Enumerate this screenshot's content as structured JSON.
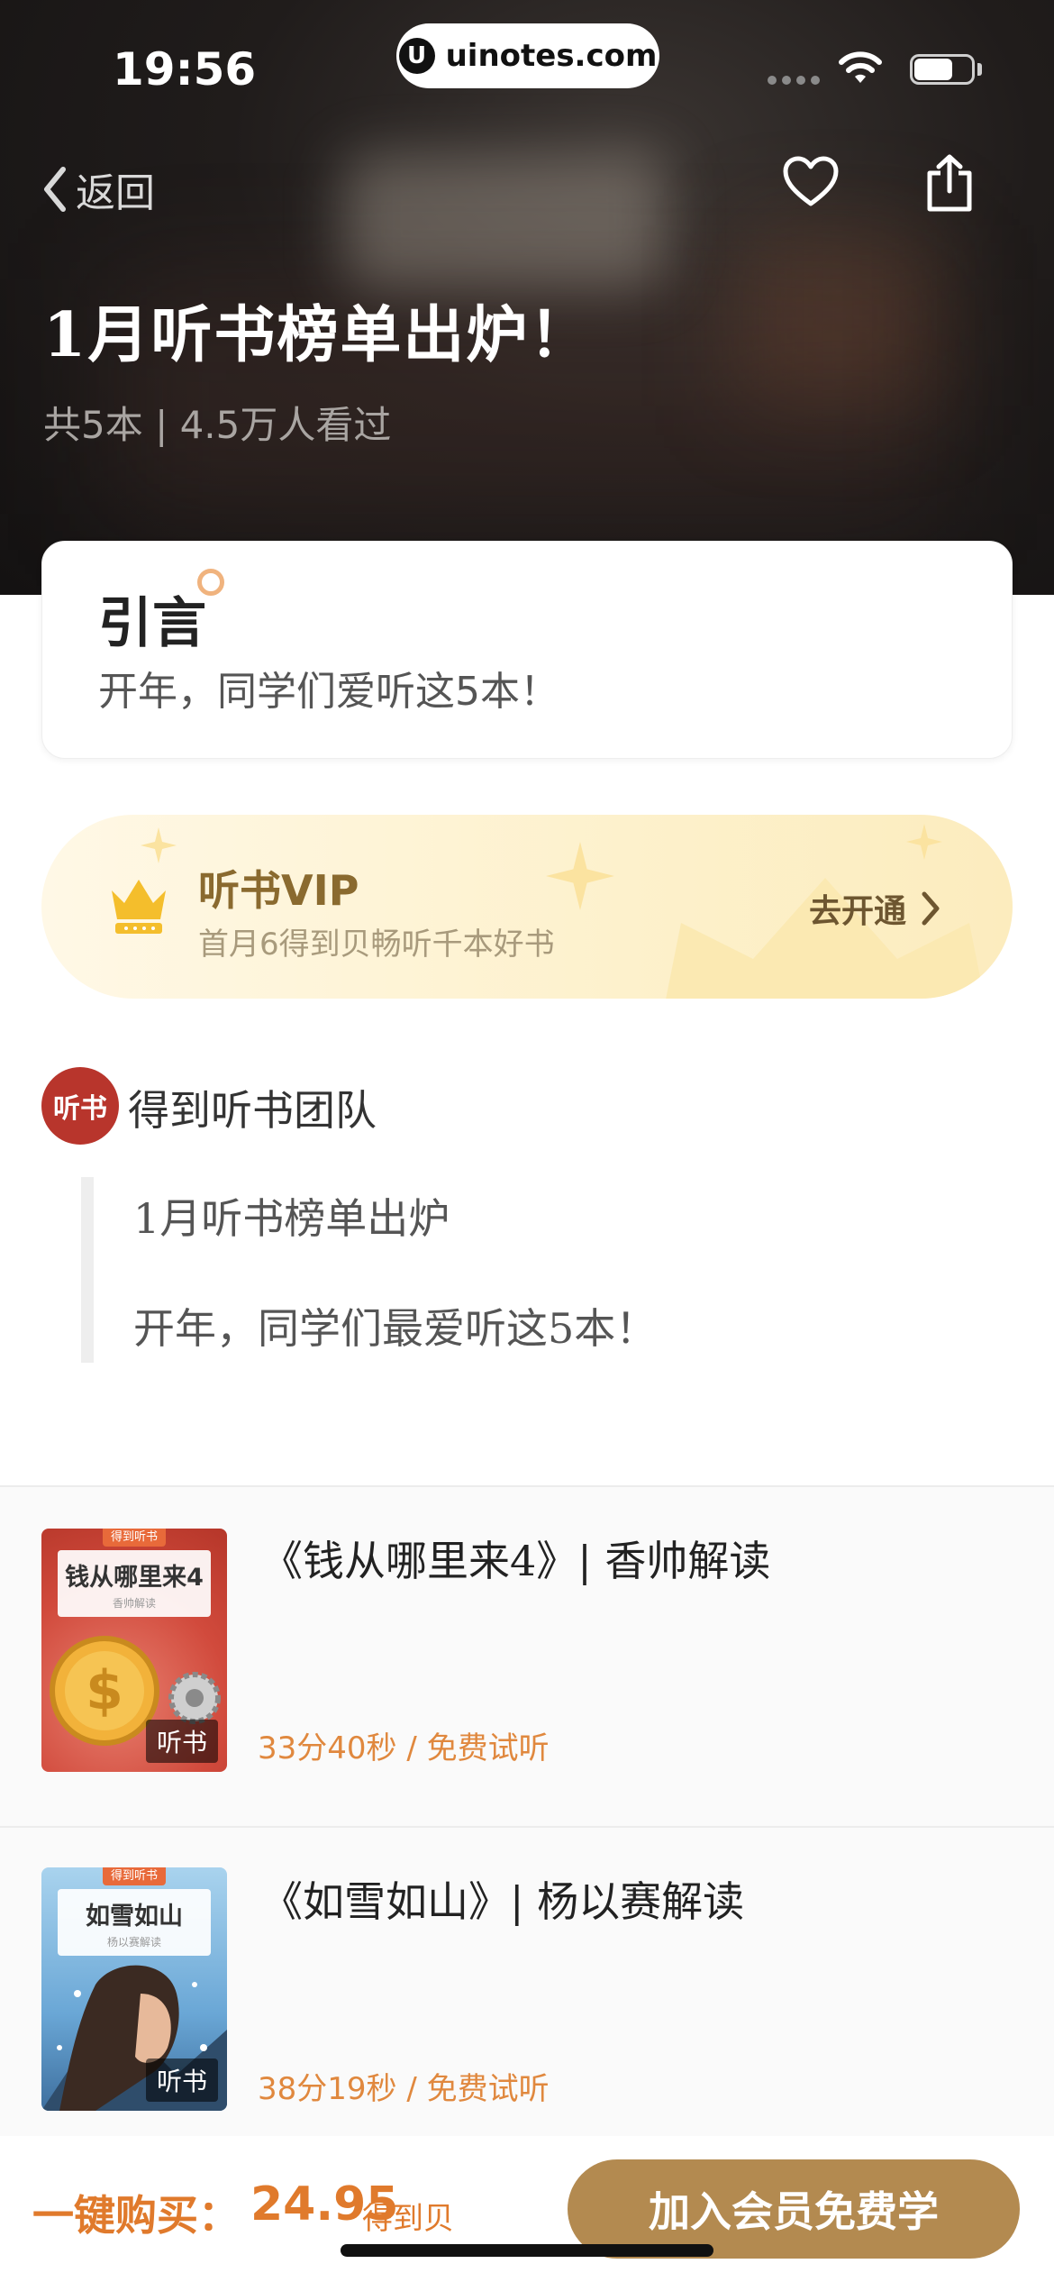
{
  "status_bar": {
    "time": "19:56",
    "url": "uinotes.com",
    "url_logo_letter": "U"
  },
  "nav": {
    "back_label": "返回"
  },
  "hero": {
    "title": "1月听书榜单出炉！",
    "subtitle": "共5本 | 4.5万人看过"
  },
  "intro": {
    "title": "引言",
    "text": "开年，同学们爱听这5本！"
  },
  "vip": {
    "title": "听书VIP",
    "subtitle": "首月6得到贝畅听千本好书",
    "action_label": "去开通"
  },
  "author": {
    "avatar_text": "听书",
    "name": "得到听书团队"
  },
  "quote": {
    "line1": "1月听书榜单出炉",
    "line2": "开年，同学们最爱听这5本！"
  },
  "books": [
    {
      "title": "《钱从哪里来4》| 香帅解读",
      "meta": "33分40秒 / 免费试听",
      "cover_badge": "得到听书",
      "cover_title": "钱从哪里来4",
      "cover_sub": "香帅解读",
      "cover_tag": "听书"
    },
    {
      "title": "《如雪如山》| 杨以赛解读",
      "meta": "38分19秒 / 免费试听",
      "cover_badge": "得到听书",
      "cover_title": "如雪如山",
      "cover_sub": "杨以赛解读",
      "cover_tag": "听书"
    }
  ],
  "bottom_bar": {
    "buy_label": "一键购买：",
    "price": "24.95",
    "price_unit": "得到贝",
    "join_label": "加入会员免费学"
  },
  "colors": {
    "accent_orange": "#e07a2c",
    "gold_button": "#b38a50",
    "avatar_red": "#b8352c"
  }
}
